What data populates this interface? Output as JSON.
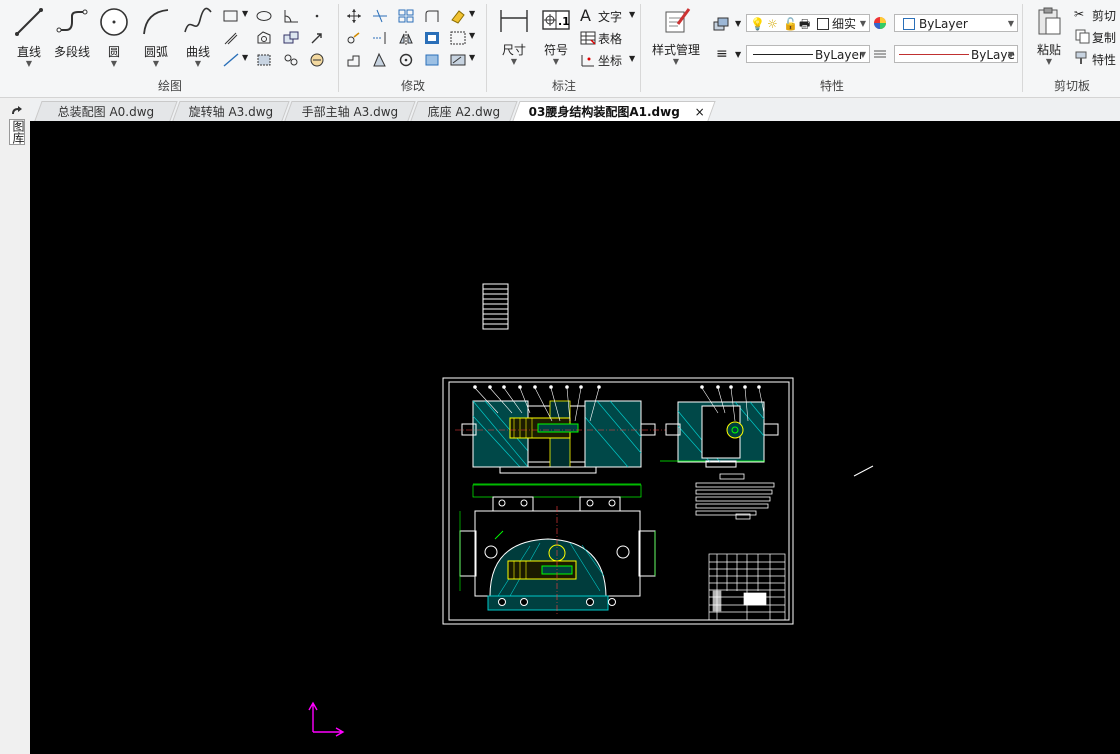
{
  "ribbon": {
    "draw": {
      "label": "绘图",
      "line": "直线",
      "polyline": "多段线",
      "circle": "圆",
      "arc": "圆弧",
      "curve": "曲线"
    },
    "modify": {
      "label": "修改"
    },
    "annotate": {
      "label": "标注",
      "dimension": "尺寸",
      "symbol": "符号",
      "text": "文字",
      "table": "表格",
      "coordinate": "坐标"
    },
    "properties": {
      "label": "特性",
      "style_manager": "样式管理",
      "layer_value": "细实",
      "color_value": "ByLayer",
      "linetype_value": "ByLayer",
      "lineweight_value": "ByLaye"
    },
    "clipboard": {
      "label": "剪切板",
      "paste": "粘贴",
      "cut": "剪切",
      "copy": "复制",
      "match_properties": "特性"
    }
  },
  "tabs": [
    {
      "label": "总装配图 A0.dwg",
      "active": false
    },
    {
      "label": "旋转轴 A3.dwg",
      "active": false
    },
    {
      "label": "手部主轴 A3.dwg",
      "active": false
    },
    {
      "label": "底座 A2.dwg",
      "active": false
    },
    {
      "label": "03腰身结构装配图A1.dwg",
      "active": true
    }
  ],
  "tab_close": "×",
  "side_panel": {
    "label": "图库"
  },
  "colors": {
    "canvas": "#000000",
    "drawing_lines": "#ffffff",
    "hatch": "#00c8c8",
    "dimension": "#00ff00",
    "highlight": "#ffff00",
    "ucs": "#ff00ff"
  }
}
